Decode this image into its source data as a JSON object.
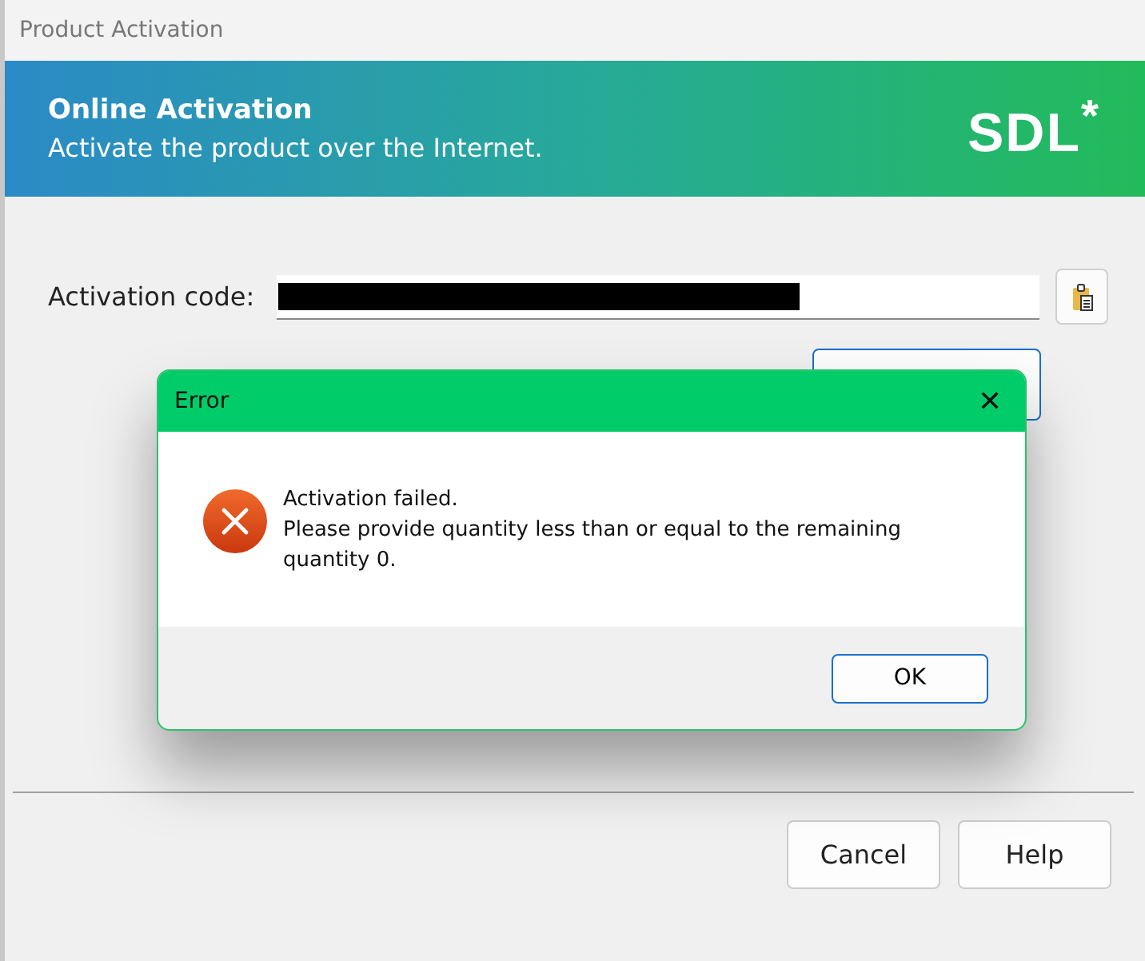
{
  "window": {
    "title": "Product Activation"
  },
  "banner": {
    "title": "Online Activation",
    "subtitle": "Activate the product over the Internet.",
    "logo": "SDL$^{*}$"
  },
  "activation_code": {
    "label": "Activation code:",
    "value_redacted": true
  },
  "buttons": [
    "Cancel",
    "Help"
  ],
  "error_dialog": {
    "title": "Error",
    "close": "✕",
    "lines": [
      "Activation failed.",
      "Please provide quantity less than or equal to the remaining quantity 0."
    ],
    "button": "OK"
  }
}
